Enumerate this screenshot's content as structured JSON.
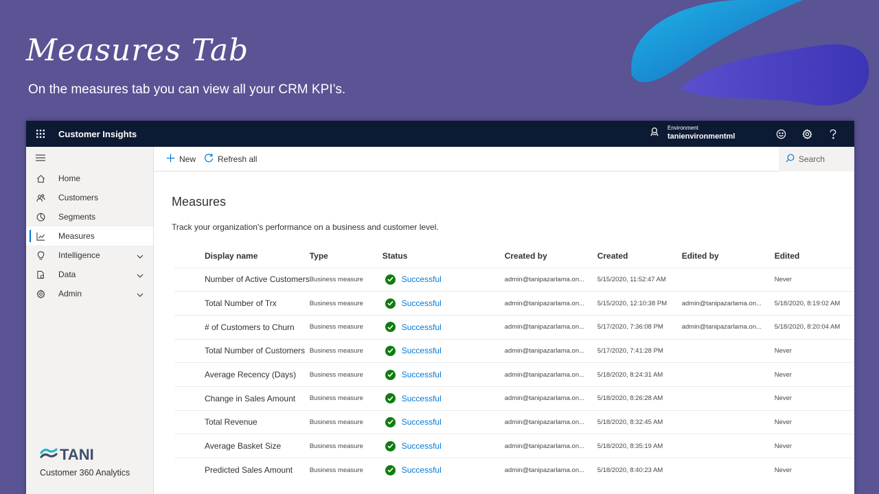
{
  "slide": {
    "title": "Measures Tab",
    "subtitle": "On the measures tab you can view all your CRM KPI’s."
  },
  "topbar": {
    "app_name": "Customer Insights",
    "environment_label": "Environment",
    "environment_name": "tanienvironmentml"
  },
  "sidebar": {
    "items": [
      {
        "label": "Home",
        "icon": "home-icon"
      },
      {
        "label": "Customers",
        "icon": "customers-icon"
      },
      {
        "label": "Segments",
        "icon": "segments-icon"
      },
      {
        "label": "Measures",
        "icon": "measures-icon",
        "active": true
      },
      {
        "label": "Intelligence",
        "icon": "lightbulb-icon",
        "expandable": true
      },
      {
        "label": "Data",
        "icon": "data-icon",
        "expandable": true
      },
      {
        "label": "Admin",
        "icon": "gear-icon",
        "expandable": true
      }
    ]
  },
  "brand": {
    "name": "TANI",
    "tagline": "Customer 360 Analytics"
  },
  "commandbar": {
    "new_label": "New",
    "refresh_label": "Refresh all",
    "search_placeholder": "Search"
  },
  "page": {
    "title": "Measures",
    "description": "Track your organization's performance on a business and customer level."
  },
  "table": {
    "headers": [
      "Display name",
      "Type",
      "Status",
      "Created by",
      "Created",
      "Edited by",
      "Edited"
    ],
    "rows": [
      [
        "Number of Active Customers",
        "Business measure",
        "Successful",
        "admin@tanipazarlama.on...",
        "5/15/2020, 11:52:47 AM",
        "",
        "Never"
      ],
      [
        "Total Number of Trx",
        "Business measure",
        "Successful",
        "admin@tanipazarlama.on...",
        "5/15/2020, 12:10:38 PM",
        "admin@tanipazarlama.on...",
        "5/18/2020, 8:19:02 AM"
      ],
      [
        "# of Customers to Churn",
        "Business measure",
        "Successful",
        "admin@tanipazarlama.on...",
        "5/17/2020, 7:36:08 PM",
        "admin@tanipazarlama.on...",
        "5/18/2020, 8:20:04 AM"
      ],
      [
        "Total Number of Customers",
        "Business measure",
        "Successful",
        "admin@tanipazarlama.on...",
        "5/17/2020, 7:41:28 PM",
        "",
        "Never"
      ],
      [
        "Average Recency (Days)",
        "Business measure",
        "Successful",
        "admin@tanipazarlama.on...",
        "5/18/2020, 8:24:31 AM",
        "",
        "Never"
      ],
      [
        "Change in Sales Amount",
        "Business measure",
        "Successful",
        "admin@tanipazarlama.on...",
        "5/18/2020, 8:26:28 AM",
        "",
        "Never"
      ],
      [
        "Total Revenue",
        "Business measure",
        "Successful",
        "admin@tanipazarlama.on...",
        "5/18/2020, 8:32:45 AM",
        "",
        "Never"
      ],
      [
        "Average Basket Size",
        "Business measure",
        "Successful",
        "admin@tanipazarlama.on...",
        "5/18/2020, 8:35:19 AM",
        "",
        "Never"
      ],
      [
        "Predicted Sales Amount",
        "Business measure",
        "Successful",
        "admin@tanipazarlama.on...",
        "5/18/2020, 8:40:23 AM",
        "",
        "Never"
      ]
    ]
  },
  "colors": {
    "slide_bg": "#5a5394",
    "topbar_bg": "#0d1a33",
    "accent": "#0078d4",
    "success": "#107c10"
  }
}
